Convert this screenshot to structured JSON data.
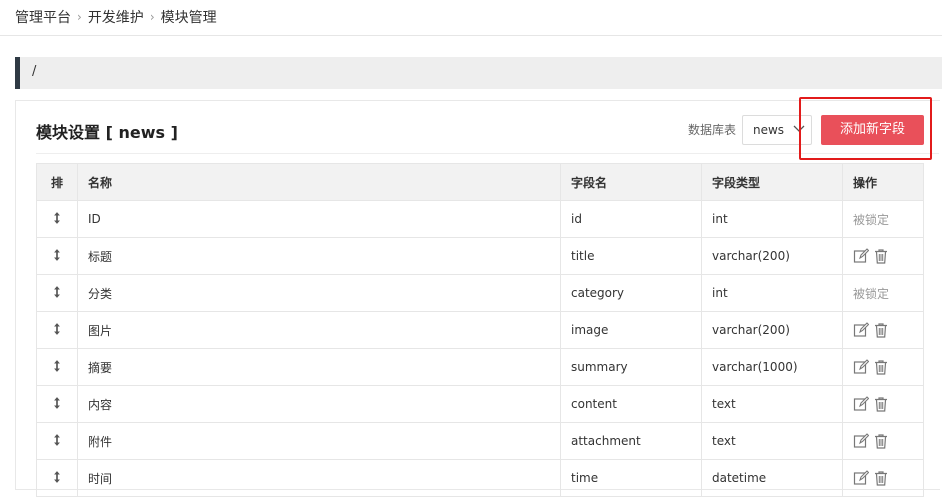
{
  "breadcrumb": [
    "管理平台",
    "开发维护",
    "模块管理"
  ],
  "path": "/",
  "card": {
    "title": "模块设置 [ news ]",
    "db_label": "数据库表",
    "db_value": "news",
    "add_button": "添加新字段"
  },
  "table": {
    "headers": [
      "排",
      "名称",
      "字段名",
      "字段类型",
      "操作"
    ],
    "rows": [
      {
        "name": "ID",
        "field": "id",
        "type": "int",
        "locked": true,
        "locked_text": "被锁定"
      },
      {
        "name": "标题",
        "field": "title",
        "type": "varchar(200)",
        "locked": false
      },
      {
        "name": "分类",
        "field": "category",
        "type": "int",
        "locked": true,
        "locked_text": "被锁定"
      },
      {
        "name": "图片",
        "field": "image",
        "type": "varchar(200)",
        "locked": false
      },
      {
        "name": "摘要",
        "field": "summary",
        "type": "varchar(1000)",
        "locked": false
      },
      {
        "name": "内容",
        "field": "content",
        "type": "text",
        "locked": false
      },
      {
        "name": "附件",
        "field": "attachment",
        "type": "text",
        "locked": false
      },
      {
        "name": "时间",
        "field": "time",
        "type": "datetime",
        "locked": false
      }
    ]
  },
  "icons": {
    "sort": "updown-arrow-icon",
    "edit": "edit-icon",
    "delete": "trash-icon",
    "chevron": "chevron-down-icon"
  },
  "colors": {
    "accent": "#e9505a",
    "highlight": "#e21b1b",
    "sidebar_bar": "#2f3a44"
  }
}
